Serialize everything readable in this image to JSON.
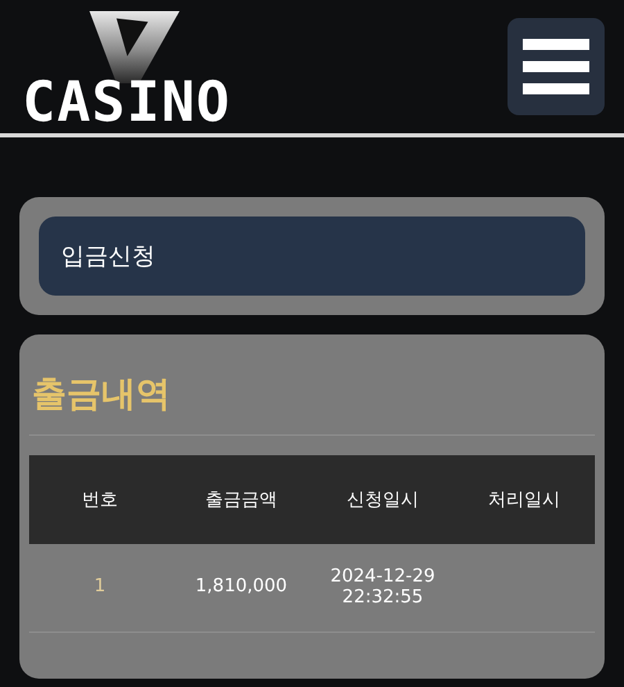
{
  "header": {
    "logo_text": "CASINO"
  },
  "deposit_button": {
    "label": "입금신청"
  },
  "withdrawals": {
    "title": "출금내역",
    "table": {
      "columns": [
        "번호",
        "출금금액",
        "신청일시",
        "처리일시"
      ],
      "rows": [
        {
          "number": "1",
          "amount": "1,810,000",
          "requested": [
            "2024-12-29",
            "22:32:55"
          ]
        }
      ]
    }
  }
}
